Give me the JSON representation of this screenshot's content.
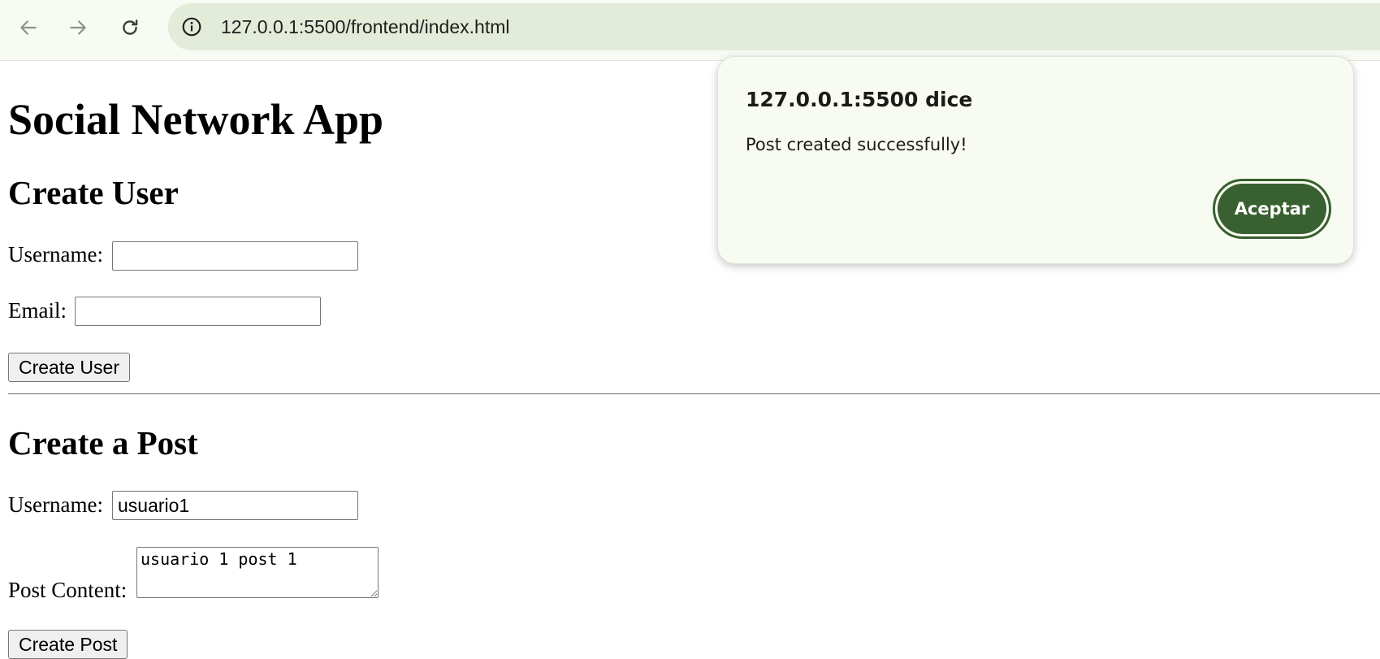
{
  "browser": {
    "url": "127.0.0.1:5500/frontend/index.html",
    "icons": {
      "back": "arrow-left-icon",
      "forward": "arrow-right-icon",
      "reload": "reload-icon",
      "site_info": "info-icon"
    }
  },
  "page": {
    "title": "Social Network App",
    "create_user": {
      "heading": "Create User",
      "username_label": "Username:",
      "username_value": "",
      "email_label": "Email:",
      "email_value": "",
      "button": "Create User"
    },
    "create_post": {
      "heading": "Create a Post",
      "username_label": "Username:",
      "username_value": "usuario1",
      "content_label": "Post Content:",
      "content_value": "usuario 1 post 1",
      "button": "Create Post"
    }
  },
  "dialog": {
    "title": "127.0.0.1:5500 dice",
    "message": "Post created successfully!",
    "ok_label": "Aceptar"
  },
  "colors": {
    "chrome_bg": "#f8fbf3",
    "omnibox_bg": "#e3ebd9",
    "dialog_bg": "#f8fbf2",
    "accent": "#386030"
  }
}
